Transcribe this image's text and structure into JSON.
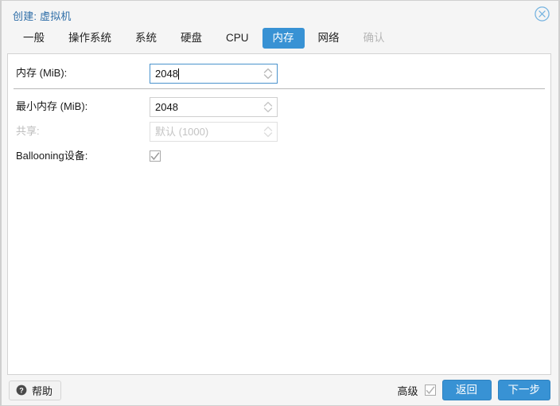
{
  "window": {
    "title": "创建: 虚拟机",
    "close_icon": "close-circle-icon"
  },
  "tabs": [
    {
      "label": "一般",
      "state": "normal"
    },
    {
      "label": "操作系统",
      "state": "normal"
    },
    {
      "label": "系统",
      "state": "normal"
    },
    {
      "label": "硬盘",
      "state": "normal"
    },
    {
      "label": "CPU",
      "state": "normal"
    },
    {
      "label": "内存",
      "state": "active"
    },
    {
      "label": "网络",
      "state": "normal"
    },
    {
      "label": "确认",
      "state": "disabled"
    }
  ],
  "form": {
    "memory": {
      "label": "内存 (MiB):",
      "value": "2048",
      "placeholder": "",
      "focused": true,
      "disabled": false,
      "spinner_icon": "spinner-updown-icon"
    },
    "min_memory": {
      "label": "最小内存 (MiB):",
      "value": "2048",
      "placeholder": "",
      "focused": false,
      "disabled": false,
      "spinner_icon": "spinner-updown-icon"
    },
    "shares": {
      "label": "共享:",
      "value": "",
      "placeholder": "默认 (1000)",
      "focused": false,
      "disabled": true,
      "spinner_icon": "spinner-updown-icon"
    },
    "ballooning": {
      "label": "Ballooning设备:",
      "checked": true,
      "check_icon": "checkmark-icon"
    }
  },
  "toolbar": {
    "help_label": "帮助",
    "help_icon": "question-circle-icon",
    "advanced_label": "高级",
    "advanced_checked": true,
    "advanced_check_icon": "checkmark-icon",
    "back_label": "返回",
    "next_label": "下一步"
  },
  "colors": {
    "accent": "#3892d4",
    "title_text": "#2f6ea8",
    "focus_border": "#4b93cd",
    "disabled_text": "#bdbdbd"
  }
}
